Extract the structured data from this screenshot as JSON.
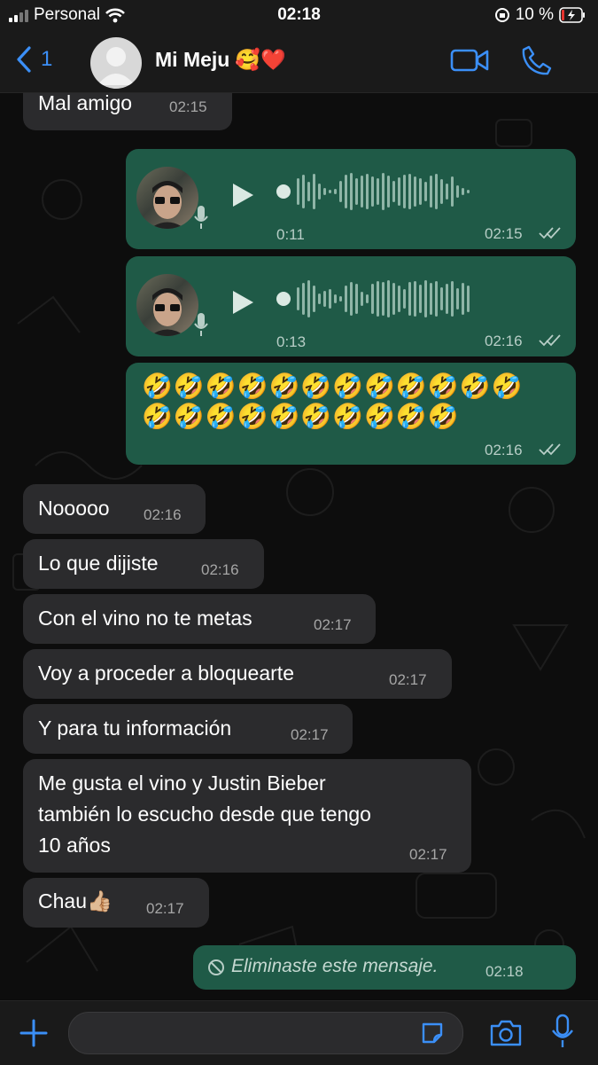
{
  "status_bar": {
    "carrier": "Personal",
    "time": "02:18",
    "battery": "10 %"
  },
  "header": {
    "back_count": "1",
    "contact_name": "Mi Meju",
    "name_emojis": "🥰❤️",
    "icons": [
      "chevron-left-icon",
      "video-call-icon",
      "phone-icon"
    ]
  },
  "messages": [
    {
      "dir": "in",
      "text": "Mal amigo",
      "time": "02:15"
    },
    {
      "dir": "out",
      "type": "voice",
      "duration": "0:11",
      "time": "02:15"
    },
    {
      "dir": "out",
      "type": "voice",
      "duration": "0:13",
      "time": "02:16"
    },
    {
      "dir": "out",
      "emoji_line1": "🤣🤣🤣🤣🤣🤣🤣🤣🤣🤣🤣🤣",
      "emoji_line2": "🤣🤣🤣🤣🤣🤣🤣🤣🤣🤣",
      "time": "02:16"
    },
    {
      "dir": "in",
      "text": "Nooooo",
      "time": "02:16"
    },
    {
      "dir": "in",
      "text": "Lo que dijiste",
      "time": "02:16"
    },
    {
      "dir": "in",
      "text": "Con el vino no te metas",
      "time": "02:17"
    },
    {
      "dir": "in",
      "text": "Voy a proceder a bloquearte",
      "time": "02:17"
    },
    {
      "dir": "in",
      "text": "Y para tu información",
      "time": "02:17"
    },
    {
      "dir": "in",
      "line1": "Me gusta el vino y Justin Bieber",
      "line2": "también lo escucho desde que tengo",
      "line3": "10 años",
      "time": "02:17"
    },
    {
      "dir": "in",
      "text": "Chau👍🏼",
      "time": "02:17"
    },
    {
      "dir": "out",
      "text": "Eliminaste este mensaje.",
      "time": "02:18",
      "deleted": true
    }
  ],
  "colors": {
    "incoming_bubble": "#2b2b2d",
    "outgoing_bubble": "#1f5a47",
    "accent": "#3b8ff7"
  }
}
